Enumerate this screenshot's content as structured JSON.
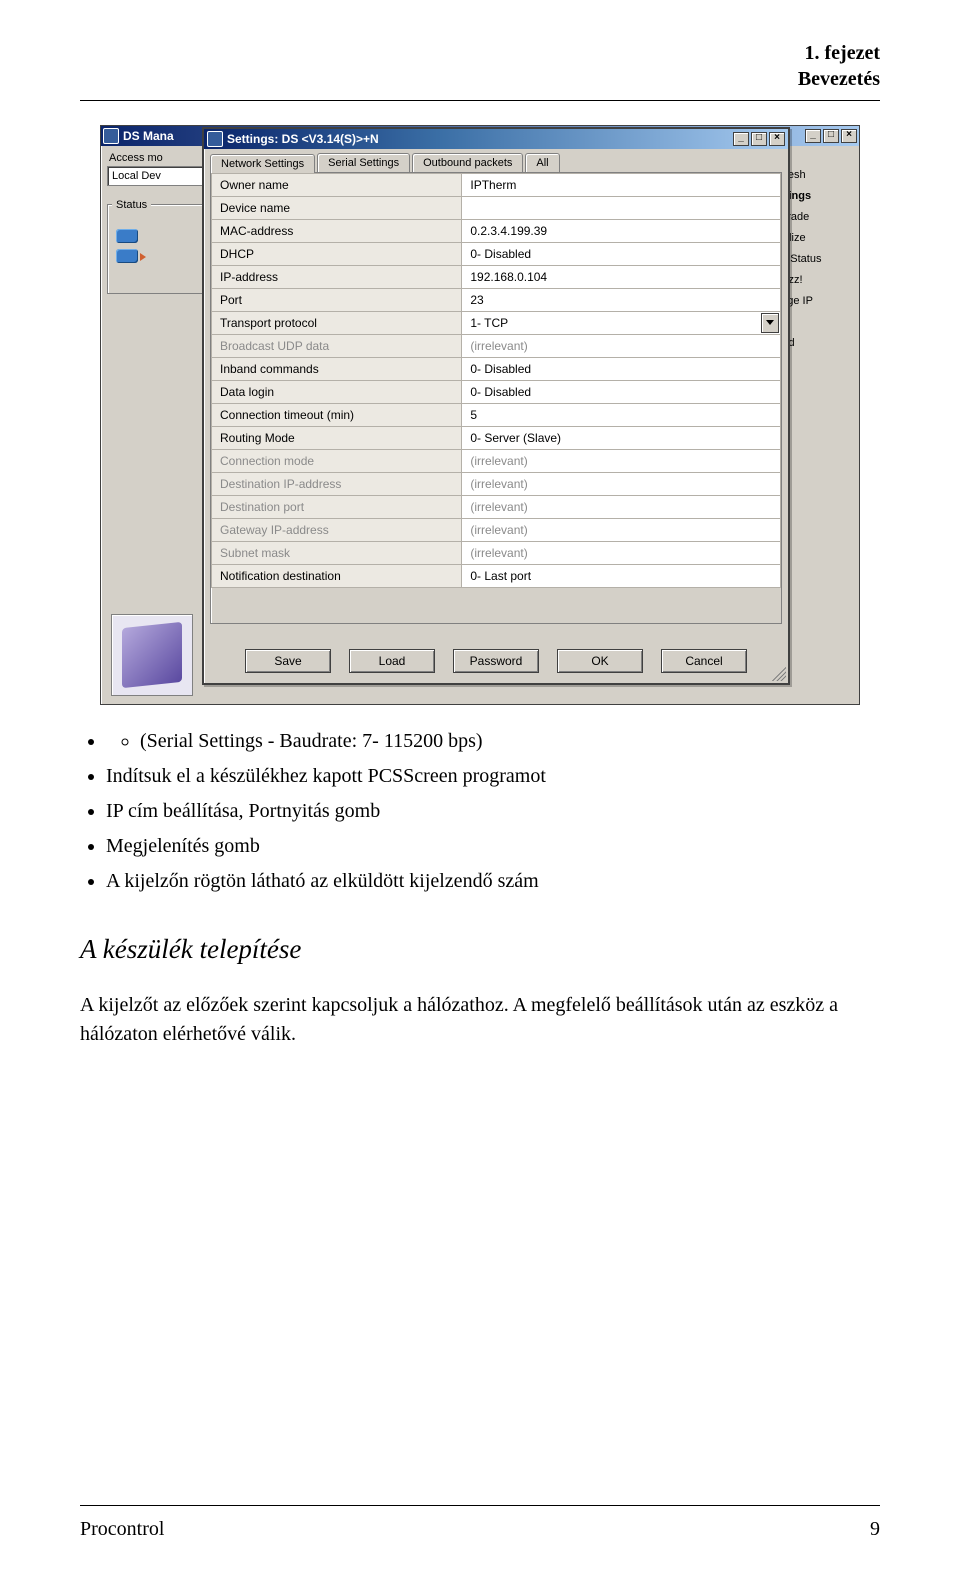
{
  "header": {
    "chapter": "1. fejezet",
    "title": "Bevezetés"
  },
  "screenshot": {
    "outer": {
      "title_prefix": "DS Mana",
      "access_mode_label": "Access mo",
      "access_mode_value": "Local Dev",
      "status_label": "Status",
      "side_buttons": [
        "efresh",
        "ettings",
        "ograde",
        "itialize",
        "ng Status",
        "Buzz!",
        "ange IP",
        "Add"
      ]
    },
    "dialog": {
      "title": "Settings: DS <V3.14(S)>+N",
      "tabs": [
        "Network Settings",
        "Serial Settings",
        "Outbound packets",
        "All"
      ],
      "active_tab": 0,
      "rows": [
        {
          "k": "Owner name",
          "v": "IPTherm",
          "dis": false
        },
        {
          "k": "Device name",
          "v": "",
          "dis": false
        },
        {
          "k": "MAC-address",
          "v": "0.2.3.4.199.39",
          "dis": false
        },
        {
          "k": "DHCP",
          "v": "0- Disabled",
          "dis": false
        },
        {
          "k": "IP-address",
          "v": "192.168.0.104",
          "dis": false
        },
        {
          "k": "Port",
          "v": "23",
          "dis": false
        },
        {
          "k": "Transport protocol",
          "v": "1- TCP",
          "dis": false,
          "sel": true
        },
        {
          "k": "Broadcast UDP data",
          "v": "(irrelevant)",
          "dis": true
        },
        {
          "k": "Inband commands",
          "v": "0- Disabled",
          "dis": false
        },
        {
          "k": "Data login",
          "v": "0- Disabled",
          "dis": false
        },
        {
          "k": "Connection timeout (min)",
          "v": "5",
          "dis": false
        },
        {
          "k": "Routing Mode",
          "v": "0- Server (Slave)",
          "dis": false
        },
        {
          "k": "Connection mode",
          "v": "(irrelevant)",
          "dis": true
        },
        {
          "k": "Destination IP-address",
          "v": "(irrelevant)",
          "dis": true
        },
        {
          "k": "Destination port",
          "v": "(irrelevant)",
          "dis": true
        },
        {
          "k": "Gateway IP-address",
          "v": "(irrelevant)",
          "dis": true
        },
        {
          "k": "Subnet mask",
          "v": "(irrelevant)",
          "dis": true
        },
        {
          "k": "Notification destination",
          "v": "0- Last port",
          "dis": false
        }
      ],
      "buttons": [
        "Save",
        "Load",
        "Password",
        "OK",
        "Cancel"
      ]
    }
  },
  "bullets": {
    "sub": "(Serial Settings - Baudrate: 7- 115200 bps)",
    "items": [
      "Indítsuk el a készülékhez kapott PCSScreen programot",
      "IP cím beállítása, Portnyitás gomb",
      "Megjelenítés gomb",
      "A kijelzőn rögtön látható az elküldött kijelzendő szám"
    ]
  },
  "section_heading": "A készülék telepítése",
  "paragraph": "A kijelzőt az előzőek szerint kapcsoljuk a hálózathoz. A megfelelő beállítások után az eszköz a hálózaton elérhetővé válik.",
  "footer": {
    "left": "Procontrol",
    "right": "9"
  }
}
